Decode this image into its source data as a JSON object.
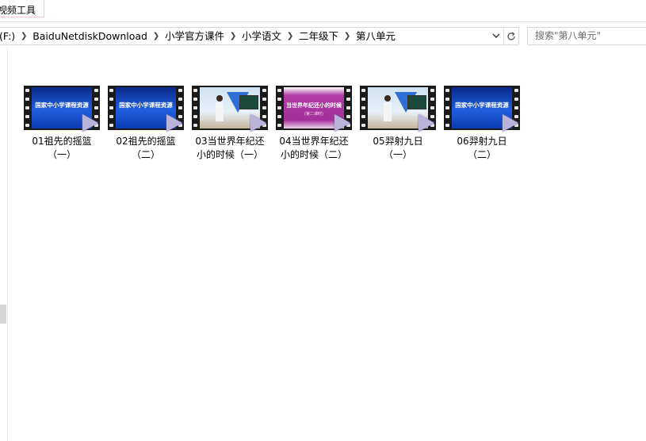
{
  "ribbon": {
    "tab_label": "视频工具"
  },
  "address": {
    "crumbs": [
      "(F:)",
      "BaiduNetdiskDownload",
      "小学官方课件",
      "小学语文",
      "二年级下",
      "第八单元"
    ]
  },
  "search": {
    "placeholder": "搜索\"第八单元\""
  },
  "thumbs": {
    "banner_text": "国家中小学课程资源",
    "lesson_title": "当世界年纪还小的时候",
    "lesson_sub": "(第二课时)"
  },
  "files": [
    {
      "name": "01祖先的摇篮（一）",
      "thumb": "blue"
    },
    {
      "name": "02祖先的摇篮（二）",
      "thumb": "blue"
    },
    {
      "name": "03当世界年纪还小的时候（一）",
      "thumb": "studio"
    },
    {
      "name": "04当世界年纪还小的时候（二）",
      "thumb": "purple"
    },
    {
      "name": "05羿射九日（一）",
      "thumb": "studio"
    },
    {
      "name": "06羿射九日（二）",
      "thumb": "blue"
    }
  ],
  "colors": {
    "ribbon_accent": "#f3c6d8",
    "banner_blue": "#1f5fe0",
    "play_badge": "#b9b3da"
  },
  "icons": {
    "crumb_separator": "chevron-right-icon",
    "address_dropdown": "chevron-down-icon",
    "refresh": "refresh-icon",
    "play_badge": "video-play-icon"
  }
}
